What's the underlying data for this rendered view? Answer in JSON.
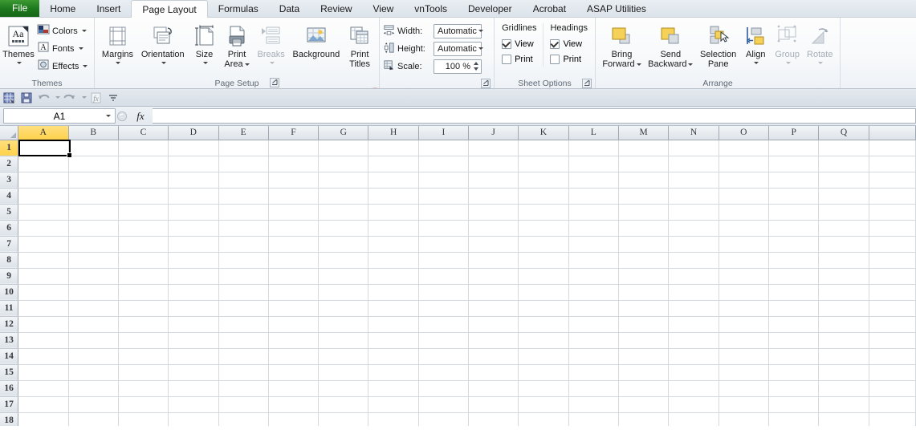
{
  "app": {
    "active_tab": "Page Layout",
    "tabs": [
      {
        "label": "File",
        "kind": "file"
      },
      {
        "label": "Home",
        "kind": "tab"
      },
      {
        "label": "Insert",
        "kind": "tab"
      },
      {
        "label": "Page Layout",
        "kind": "tab"
      },
      {
        "label": "Formulas",
        "kind": "tab"
      },
      {
        "label": "Data",
        "kind": "tab"
      },
      {
        "label": "Review",
        "kind": "tab"
      },
      {
        "label": "View",
        "kind": "tab"
      },
      {
        "label": "vnTools",
        "kind": "tab"
      },
      {
        "label": "Developer",
        "kind": "tab"
      },
      {
        "label": "Acrobat",
        "kind": "tab"
      },
      {
        "label": "ASAP Utilities",
        "kind": "tab"
      }
    ]
  },
  "ribbon": {
    "groups": [
      {
        "name": "Themes",
        "label": "Themes",
        "big_buttons": [
          {
            "label": "Themes",
            "label2": "",
            "icon": "themes-icon",
            "dropdown": true,
            "disabled": false
          }
        ],
        "small_buttons": [
          {
            "label": "Colors",
            "icon": "theme-colors-icon",
            "dropdown": true
          },
          {
            "label": "Fonts",
            "icon": "theme-fonts-icon",
            "dropdown": true
          },
          {
            "label": "Effects",
            "icon": "theme-effects-icon",
            "dropdown": true
          }
        ],
        "has_launcher": false
      },
      {
        "name": "Page Setup",
        "label": "Page Setup",
        "big_buttons": [
          {
            "label": "Margins",
            "label2": "",
            "icon": "margins-icon",
            "dropdown": true,
            "disabled": false
          },
          {
            "label": "Orientation",
            "label2": "",
            "icon": "orientation-icon",
            "dropdown": true,
            "disabled": false
          },
          {
            "label": "Size",
            "label2": "",
            "icon": "size-icon",
            "dropdown": true,
            "disabled": false
          },
          {
            "label": "Print",
            "label2": "Area",
            "icon": "print-area-icon",
            "dropdown": true,
            "disabled": false
          },
          {
            "label": "Breaks",
            "label2": "",
            "icon": "breaks-icon",
            "dropdown": true,
            "disabled": true
          },
          {
            "label": "Background",
            "label2": "",
            "icon": "background-icon",
            "dropdown": false,
            "disabled": false
          },
          {
            "label": "Print",
            "label2": "Titles",
            "icon": "print-titles-icon",
            "dropdown": false,
            "disabled": false
          }
        ],
        "has_launcher": true
      },
      {
        "name": "Scale to Fit",
        "label": "",
        "fields": [
          {
            "label": "Width:",
            "value": "Automatic",
            "icon": "scale-width-icon",
            "type": "combo"
          },
          {
            "label": "Height:",
            "value": "Automatic",
            "icon": "scale-height-icon",
            "type": "combo"
          },
          {
            "label": "Scale:",
            "value": "100 %",
            "icon": "scale-icon",
            "type": "spin"
          }
        ],
        "has_launcher": true
      },
      {
        "name": "Sheet Options",
        "label": "Sheet Options",
        "columns": [
          {
            "head": "Gridlines",
            "items": [
              {
                "label": "View",
                "checked": true
              },
              {
                "label": "Print",
                "checked": false
              }
            ]
          },
          {
            "head": "Headings",
            "items": [
              {
                "label": "View",
                "checked": true
              },
              {
                "label": "Print",
                "checked": false
              }
            ]
          }
        ],
        "has_launcher": true
      },
      {
        "name": "Arrange",
        "label": "Arrange",
        "big_buttons": [
          {
            "label": "Bring",
            "label2": "Forward",
            "icon": "bring-forward-icon",
            "dropdown": true,
            "inline_caret": true,
            "disabled": false
          },
          {
            "label": "Send",
            "label2": "Backward",
            "icon": "send-backward-icon",
            "dropdown": true,
            "inline_caret": true,
            "disabled": false
          },
          {
            "label": "Selection",
            "label2": "Pane",
            "icon": "selection-pane-icon",
            "dropdown": false,
            "disabled": false
          },
          {
            "label": "Align",
            "label2": "",
            "icon": "align-icon",
            "dropdown": true,
            "disabled": false
          },
          {
            "label": "Group",
            "label2": "",
            "icon": "group-icon",
            "dropdown": true,
            "disabled": true
          },
          {
            "label": "Rotate",
            "label2": "",
            "icon": "rotate-icon",
            "dropdown": true,
            "disabled": true
          }
        ],
        "has_launcher": false
      }
    ]
  },
  "annotation": {
    "color": "#c00000",
    "shapes": [
      "red-ellipse-around-page-setup-launcher",
      "red-arrow-pointing-left"
    ]
  },
  "quick_access": {
    "buttons": [
      {
        "name": "excel-app-icon",
        "label": ""
      },
      {
        "name": "save-icon",
        "label": ""
      },
      {
        "name": "undo-icon",
        "label": "",
        "dropdown": true,
        "disabled": true
      },
      {
        "name": "redo-icon",
        "label": "",
        "dropdown": true,
        "disabled": true
      },
      {
        "name": "calculate-icon",
        "label": "",
        "disabled": true
      },
      {
        "name": "customize-qat-icon",
        "label": ""
      }
    ]
  },
  "formula_bar": {
    "name_box_value": "A1",
    "formula_value": "",
    "fx_label": "fx"
  },
  "grid": {
    "columns": [
      "A",
      "B",
      "C",
      "D",
      "E",
      "F",
      "G",
      "H",
      "I",
      "J",
      "K",
      "L",
      "M",
      "N",
      "O",
      "P",
      "Q"
    ],
    "rows": [
      1,
      2,
      3,
      4,
      5,
      6,
      7,
      8,
      9,
      10,
      11,
      12,
      13,
      14,
      15,
      16,
      17,
      18
    ],
    "selected_cell": "A1",
    "selected_column": "A",
    "selected_row": 1
  },
  "colors": {
    "file_tab_green": "#1e7a1e",
    "annotation_red": "#c00000",
    "selection_yellow": "#ffd24d",
    "ribbon_bg": "#f7f9fb"
  }
}
